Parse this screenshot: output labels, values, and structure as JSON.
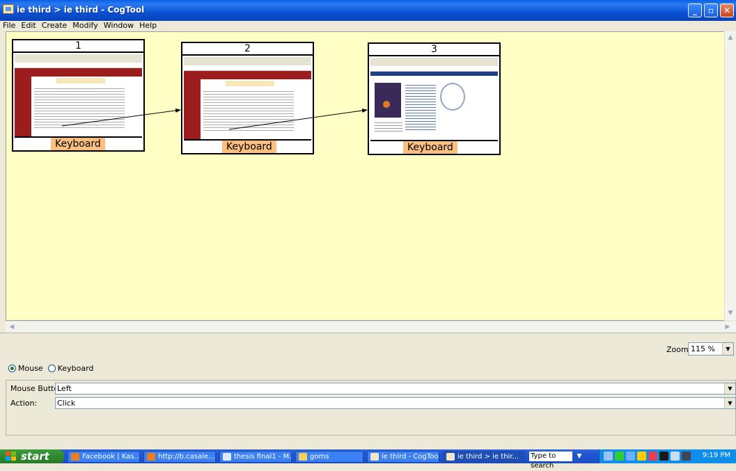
{
  "window": {
    "title": "ie third > ie third - CogTool"
  },
  "menu": [
    "File",
    "Edit",
    "Create",
    "Modify",
    "Window",
    "Help"
  ],
  "frames": [
    {
      "name": "1",
      "widget": "Keyboard"
    },
    {
      "name": "2",
      "widget": "Keyboard"
    },
    {
      "name": "3",
      "widget": "Keyboard"
    }
  ],
  "zoom": {
    "label": "Zoom:",
    "value": "115 %"
  },
  "device": {
    "mouse_label": "Mouse",
    "keyboard_label": "Keyboard",
    "selected": "Mouse"
  },
  "properties": {
    "mouse_button_label": "Mouse Button:",
    "mouse_button_value": "Left",
    "action_label": "Action:",
    "action_value": "Click"
  },
  "taskbar": {
    "start_label": "start",
    "tasks": [
      "Facebook | Kas...",
      "http://b.casale...",
      "thesis final1 - M...",
      "goms",
      "ie third - CogTool",
      "ie third > ie thir..."
    ],
    "search_placeholder": "Type to search",
    "clock": "9:19 PM"
  },
  "colors": {
    "canvas": "#ffffc5",
    "widget": "#fbbf7f",
    "taskbar": "#2157d3",
    "start": "#2f8a2f"
  }
}
